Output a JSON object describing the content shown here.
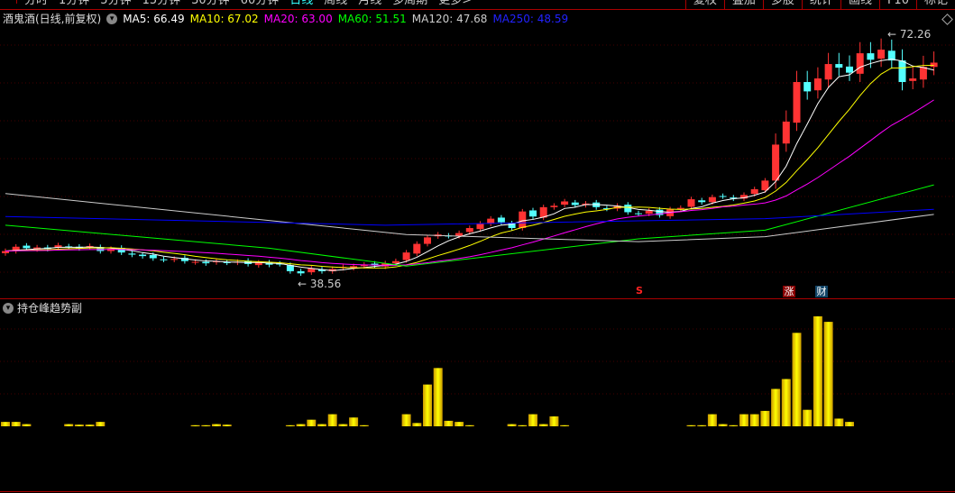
{
  "tabs": [
    "分时",
    "1分钟",
    "5分钟",
    "15分钟",
    "30分钟",
    "60分钟",
    "日线",
    "周线",
    "月线",
    "多周期",
    "更多>"
  ],
  "active_tab": "日线",
  "right_buttons": [
    "复权",
    "叠加",
    "多股",
    "统计",
    "画线",
    "F10",
    "标记"
  ],
  "legend": {
    "title": "酒鬼酒(日线,前复权)",
    "ma5": "MA5: 66.49",
    "ma10": "MA10: 67.02",
    "ma20": "MA20: 63.00",
    "ma60": "MA60: 51.51",
    "ma120": "MA120: 47.68",
    "ma250": "MA250: 48.59"
  },
  "colors": {
    "up": "#ff3333",
    "down": "#54ffff",
    "ma5": "#ffffff",
    "ma10": "#ffff00",
    "ma20": "#ff00ff",
    "ma60": "#00ff00",
    "ma120": "#cccccc",
    "ma250": "#0000ff"
  },
  "annotations": {
    "high": "72.26",
    "low": "38.56",
    "signal_s": "S",
    "mark_zhang": "涨",
    "mark_cai": "财"
  },
  "sub_panel": {
    "title": "持仓峰趋势副"
  },
  "chart_data": {
    "type": "candlestick",
    "closes": [
      42.0,
      42.6,
      42.4,
      42.5,
      42.3,
      42.8,
      42.6,
      42.4,
      42.7,
      42.0,
      42.3,
      41.8,
      41.5,
      41.3,
      41.0,
      40.8,
      40.9,
      40.6,
      40.5,
      40.3,
      40.6,
      40.4,
      40.5,
      40.2,
      40.4,
      40.1,
      40.2,
      39.2,
      38.9,
      39.6,
      39.2,
      39.5,
      39.8,
      39.9,
      40.1,
      40.0,
      40.3,
      40.6,
      41.8,
      43.0,
      43.9,
      44.3,
      44.1,
      44.5,
      45.2,
      45.8,
      46.5,
      46.0,
      45.2,
      47.5,
      46.8,
      48.1,
      48.3,
      48.9,
      48.4,
      48.6,
      48.1,
      47.9,
      48.3,
      47.4,
      47.2,
      47.6,
      47.0,
      47.8,
      48.0,
      49.2,
      48.8,
      49.5,
      49.6,
      49.3,
      49.8,
      50.6,
      51.8,
      56.8,
      60.0,
      65.5,
      64.2,
      66.0,
      68.0,
      67.5,
      66.8,
      69.5,
      68.6,
      70.0,
      68.5,
      65.5,
      66.0,
      67.6,
      68.2
    ],
    "ma60": [
      [
        0,
        45.6
      ],
      [
        25,
        42.4
      ],
      [
        38,
        39.9
      ],
      [
        60,
        43.7
      ],
      [
        72,
        44.9
      ],
      [
        88,
        51.2
      ]
    ],
    "ma120": [
      [
        0,
        50.0
      ],
      [
        38,
        44.3
      ],
      [
        60,
        43.3
      ],
      [
        72,
        44.0
      ],
      [
        88,
        47.1
      ]
    ],
    "ma250": [
      [
        0,
        46.8
      ],
      [
        36,
        45.6
      ],
      [
        60,
        46.2
      ],
      [
        72,
        46.5
      ],
      [
        88,
        47.8
      ]
    ],
    "volume": {
      "0": 4,
      "1": 4,
      "2": 2,
      "6": 2,
      "7": 1.5,
      "8": 1.5,
      "9": 4,
      "18": 1,
      "19": 1,
      "20": 2,
      "21": 1.5,
      "27": 1,
      "28": 2,
      "29": 6,
      "30": 2,
      "31": 11,
      "32": 2,
      "33": 8,
      "34": 1,
      "38": 11,
      "39": 3,
      "40": 38,
      "41": 53,
      "42": 5,
      "43": 4,
      "44": 1,
      "48": 2,
      "49": 1,
      "50": 11,
      "51": 2,
      "52": 9,
      "53": 1,
      "65": 1,
      "66": 1,
      "67": 11,
      "68": 2,
      "69": 1,
      "70": 11,
      "71": 11,
      "72": 14,
      "73": 34,
      "74": 43,
      "75": 85,
      "76": 15,
      "77": 100,
      "78": 95,
      "79": 7,
      "80": 4
    },
    "price_range": [
      38.56,
      72.26
    ]
  }
}
